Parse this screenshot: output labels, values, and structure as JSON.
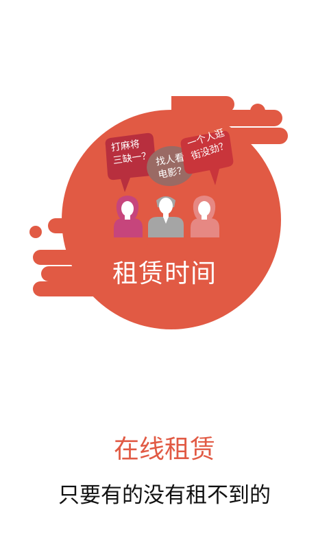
{
  "hero": {
    "title": "租赁时间",
    "bubbles": [
      {
        "line1": "打麻将",
        "line2": "三缺一？"
      },
      {
        "line1": "找人看",
        "line2": "电影？"
      },
      {
        "line1": "一个人逛",
        "line2": "街没劲？"
      }
    ]
  },
  "headline": "在线租赁",
  "subline": "只要有的没有租不到的",
  "colors": {
    "accent": "#e15a44",
    "bubble_dark": "#b82f3e",
    "bubble_gray": "#9a6a64",
    "bubble_red": "#c9353b",
    "person_pink": "#c6457c",
    "person_gray": "#a5a5a5",
    "person_salmon": "#e68883"
  }
}
